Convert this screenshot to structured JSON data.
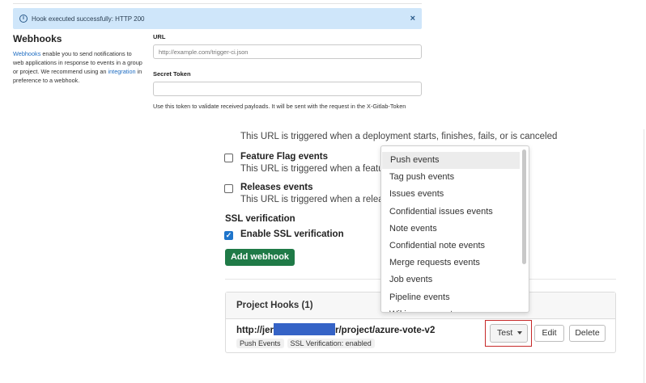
{
  "alert": {
    "message": "Hook executed successfully: HTTP 200",
    "close_symbol": "×",
    "info_symbol": "i"
  },
  "webhooks_intro": {
    "title": "Webhooks",
    "link_webhooks": "Webhooks",
    "text1": " enable you to send notifications to web applications in response to events in a group or project. We recommend using an ",
    "link_integration": "integration",
    "text2": " in preference to a webhook."
  },
  "form": {
    "url_label": "URL",
    "url_placeholder": "http://example.com/trigger-ci.json",
    "secret_label": "Secret Token",
    "secret_value": "",
    "secret_help": "Use this token to validate received payloads. It will be sent with the request in the X-Gitlab-Token"
  },
  "events": {
    "deployment_desc": "This URL is triggered when a deployment starts, finishes, fails, or is canceled",
    "feature_flag": {
      "title": "Feature Flag events",
      "desc": "This URL is triggered when a featur",
      "checked": false
    },
    "releases": {
      "title": "Releases events",
      "desc": "This URL is triggered when a releas",
      "checked": false
    }
  },
  "ssl": {
    "heading": "SSL verification",
    "enable_label": "Enable SSL verification",
    "enable_checked": true,
    "check_symbol": "✓"
  },
  "add_button": "Add webhook",
  "project_hooks": {
    "header": "Project Hooks (1)",
    "hook": {
      "url_start": "http://jer",
      "url_end": "r/project/azure-vote-v2",
      "badges": [
        "Push Events",
        "SSL Verification: enabled"
      ]
    },
    "test_button": "Test",
    "edit_button": "Edit",
    "delete_button": "Delete"
  },
  "test_dropdown": {
    "items": [
      "Push events",
      "Tag push events",
      "Issues events",
      "Confidential issues events",
      "Note events",
      "Confidential note events",
      "Merge requests events",
      "Job events",
      "Pipeline events",
      "Wiki page events"
    ],
    "highlighted": "Push events"
  },
  "colors": {
    "alert_bg": "#cfe6fa",
    "link": "#1f6dc2",
    "add_button_bg": "#1f7a47",
    "checkbox_checked": "#1f75cb",
    "highlight_box": "#c62828",
    "redaction": "#3563c6"
  }
}
